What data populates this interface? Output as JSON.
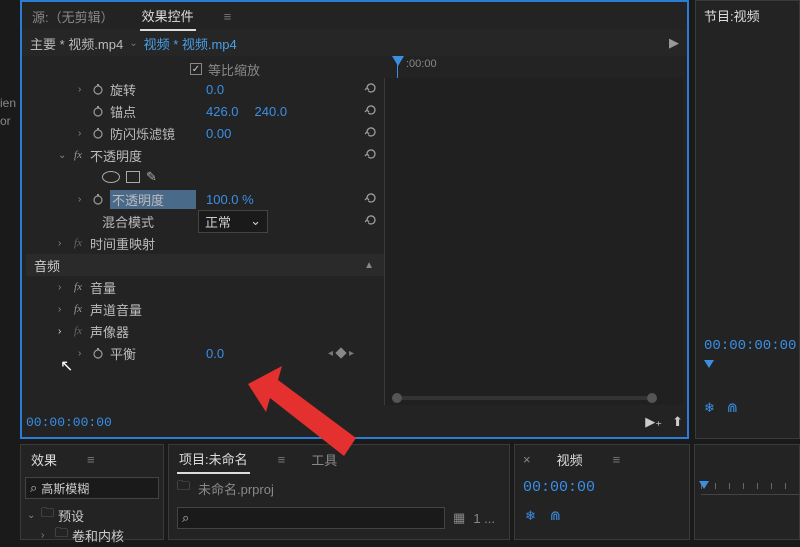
{
  "effectControls": {
    "sourceTab": "源:（无剪辑）",
    "controlsTab": "效果控件",
    "clipMaster": "主要 * 视频.mp4",
    "clipActive": "视频 * 视频.mp4",
    "timelineZero": ":00:00",
    "timecode": "00:00:00:00",
    "uniformScale": "等比缩放",
    "rows": {
      "rotation": {
        "label": "旋转",
        "value": "0.0"
      },
      "anchor": {
        "label": "锚点",
        "x": "426.0",
        "y": "240.0"
      },
      "antiflicker": {
        "label": "防闪烁滤镜",
        "value": "0.00"
      },
      "opacityGroup": "不透明度",
      "opacity": {
        "label": "不透明度",
        "value": "100.0 %"
      },
      "blend": {
        "label": "混合模式",
        "value": "正常"
      },
      "timeRemap": "时间重映射",
      "audioSection": "音频",
      "volume": "音量",
      "channelVolume": "声道音量",
      "panner": "声像器",
      "balance": {
        "label": "平衡",
        "value": "0.0"
      }
    }
  },
  "programPanel": {
    "tab": "节目:视频",
    "timecode": "00:00:00:00"
  },
  "effectsPanel": {
    "tab": "效果",
    "search": "高斯模糊",
    "bins": {
      "presets": "预设",
      "lumetri": "卷和内核"
    }
  },
  "projectPanel": {
    "projectTab": "项目:未命名",
    "toolsTab": "工具",
    "projFile": "未命名.prproj",
    "searchPlaceholder": "",
    "itemCount": "1 ..."
  },
  "sourcePanel": {
    "tab": "视频",
    "timecode": "00:00:00"
  },
  "leftFragment": "ien\nor"
}
